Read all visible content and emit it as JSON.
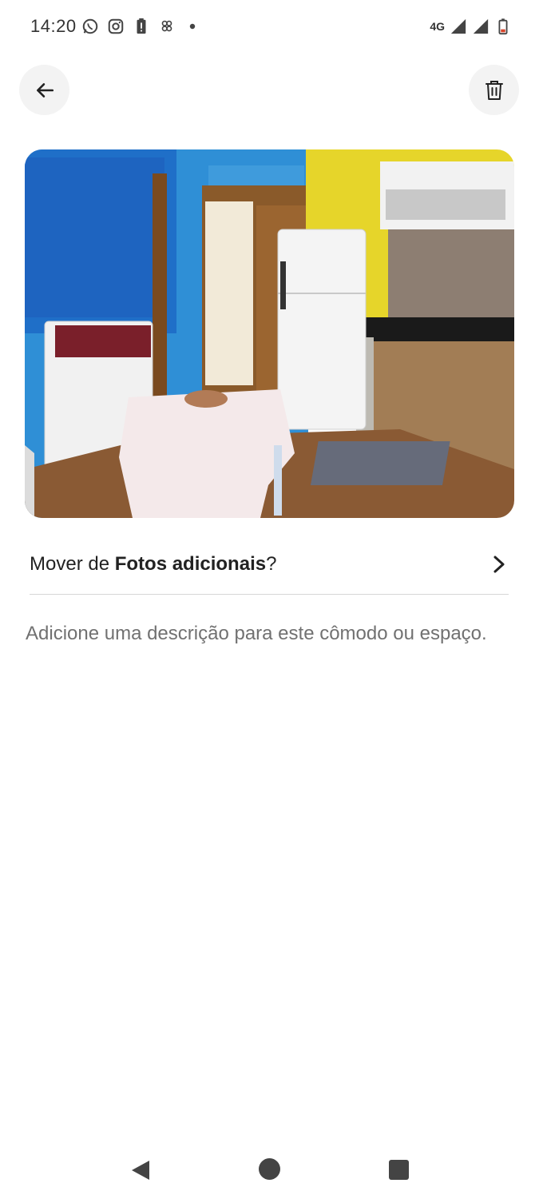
{
  "status_bar": {
    "time": "14:20",
    "network_label": "4G",
    "left_icons": [
      "whatsapp-icon",
      "instagram-icon",
      "battery-alert-icon",
      "app-notification-icon",
      "dot-icon"
    ],
    "right_icons": [
      "signal-icon",
      "signal-icon",
      "battery-icon"
    ]
  },
  "header": {
    "back_icon": "arrow-left-icon",
    "delete_icon": "trash-icon"
  },
  "photo": {
    "subject": "room-photo"
  },
  "move_row": {
    "prefix": "Mover de ",
    "album": "Fotos adicionais",
    "suffix": "?",
    "icon": "chevron-right-icon"
  },
  "description": {
    "placeholder": "Adicione uma descrição para este cômodo ou espaço."
  },
  "nav_bar": {
    "icons": [
      "nav-back-icon",
      "nav-home-icon",
      "nav-recents-icon"
    ]
  },
  "colors": {
    "text_primary": "#222222",
    "text_secondary": "#717171",
    "button_bg": "#f3f3f3",
    "divider": "#d6d6d6"
  }
}
